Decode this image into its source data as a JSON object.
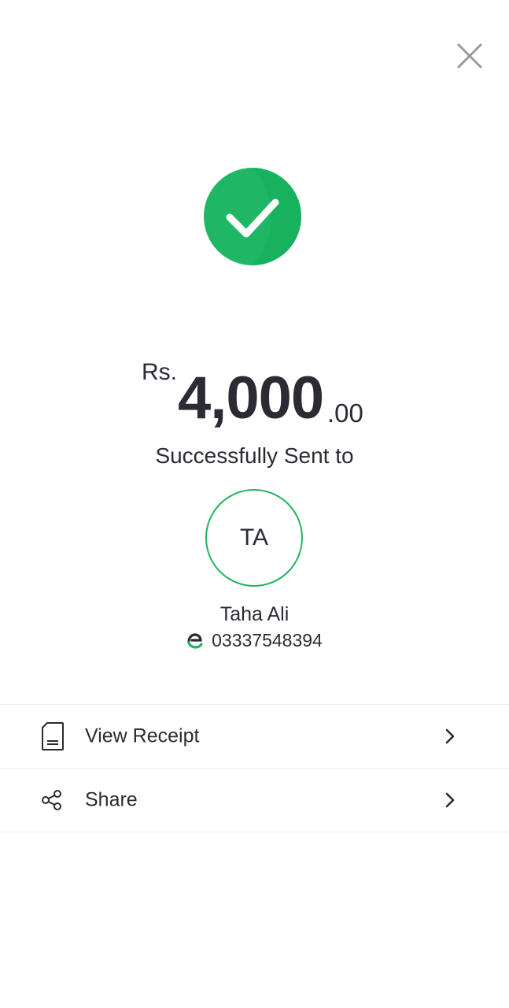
{
  "header": {
    "close_icon": "close-icon"
  },
  "status": {
    "icon": "check-circle-icon",
    "color": "#1fb765"
  },
  "amount": {
    "currency": "Rs.",
    "whole": "4,000",
    "decimal": ".00"
  },
  "message": "Successfully Sent to",
  "recipient": {
    "initials": "TA",
    "name": "Taha Ali",
    "wallet_icon": "easypaisa-logo-icon",
    "number": "03337548394",
    "ring_color": "#22b35e"
  },
  "actions": [
    {
      "label": "View Receipt",
      "icon": "receipt-icon"
    },
    {
      "label": "Share",
      "icon": "share-icon"
    }
  ],
  "colors": {
    "text": "#2b2a35",
    "accent": "#1fb765",
    "divider": "#ececec"
  }
}
